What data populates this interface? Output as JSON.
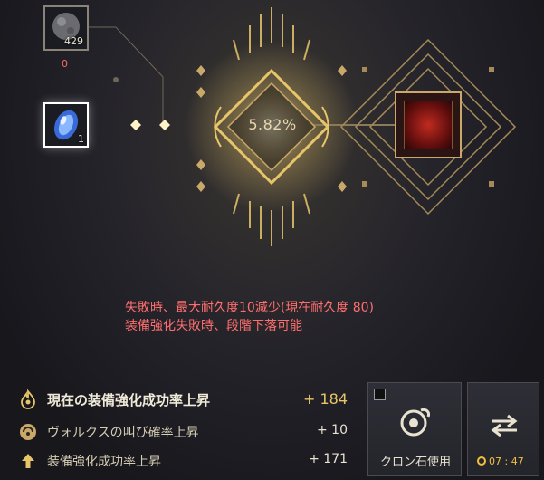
{
  "materials": {
    "black_stone_count": "429",
    "black_stone_owned": "0",
    "crystal_count": "1"
  },
  "enhance": {
    "success_rate": "5.82%"
  },
  "warnings": [
    "失敗時、最大耐久度10減少(現在耐久度 80)",
    "装備強化失敗時、段階下落可能"
  ],
  "stats": {
    "total_label": "現在の装備強化成功率上昇",
    "total_value": "+ 184",
    "valks_label": "ヴォルクスの叫び確率上昇",
    "valks_value": "+ 10",
    "success_label": "装備強化成功率上昇",
    "success_value": "+ 171"
  },
  "buttons": {
    "cron_label": "クロン石使用",
    "timer": "07 : 47"
  },
  "icons": {
    "total": "flame-swirl-icon",
    "valks": "valks-cry-icon",
    "success": "up-arrow-icon",
    "cron": "cron-stone-icon",
    "swap": "swap-arrows-icon",
    "timer": "stopwatch-icon"
  },
  "colors": {
    "gold": "#e8c56a",
    "warning": "#ff6e6e",
    "timer": "#f0c040"
  }
}
